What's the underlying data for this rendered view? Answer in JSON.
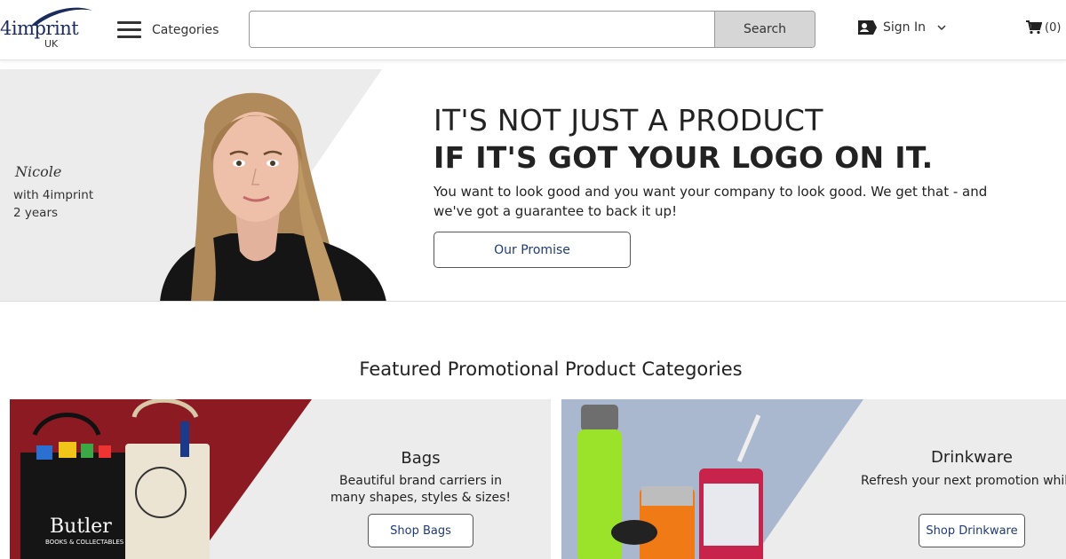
{
  "header": {
    "logo_text": "4imprint",
    "logo_region": "UK",
    "menu_label": "Categories",
    "search_placeholder": "",
    "search_button": "Search",
    "signin_label": "Sign In",
    "cart_count": "(0)"
  },
  "hero": {
    "person_name": "Nicole",
    "person_company": "with 4imprint",
    "person_tenure": "2 years",
    "headline_1": "IT'S NOT JUST A PRODUCT",
    "headline_2": "IF IT'S GOT YOUR LOGO ON IT.",
    "description": "You want to look good and you want your company to look good. We get that - and we've got a guarantee to back it up!",
    "button_label": "Our Promise"
  },
  "featured": {
    "title": "Featured Promotional Product Categories",
    "cards": [
      {
        "title": "Bags",
        "description": "Beautiful brand carriers in many shapes, styles & sizes!",
        "button": "Shop Bags",
        "bag_text_1": "Butler",
        "bag_text_2": "BOOKS & COLLECTABLES"
      },
      {
        "title": "Drinkware",
        "description": "Refresh your next promotion while quenching their thirst!",
        "button": "Shop Drinkware"
      }
    ]
  },
  "colors": {
    "brand_navy": "#1a2b5c",
    "link_blue": "#1f3b73",
    "bags_accent": "#8b1a22",
    "drinkware_bg": "#a9b8cf"
  }
}
